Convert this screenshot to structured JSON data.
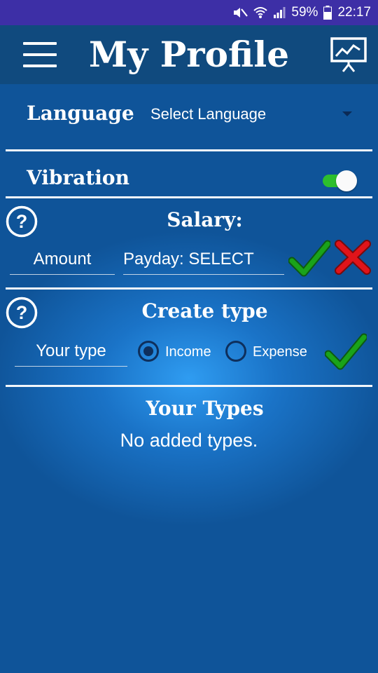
{
  "status_bar": {
    "battery": "59%",
    "time": "22:17",
    "icons": [
      "mute-icon",
      "wifi-icon",
      "signal-icon",
      "battery-icon"
    ]
  },
  "app_bar": {
    "title": "My Profile",
    "menu_icon": "hamburger-menu-icon",
    "chart_icon": "presentation-chart-icon"
  },
  "language": {
    "label": "Language",
    "selected": "Select Language"
  },
  "vibration": {
    "label": "Vibration",
    "enabled": true
  },
  "salary": {
    "title": "Salary:",
    "amount_placeholder": "Amount",
    "payday": "Payday: SELECT"
  },
  "create_type": {
    "title": "Create type",
    "type_placeholder": "Your type",
    "options": [
      {
        "label": "Income",
        "checked": true
      },
      {
        "label": "Expense",
        "checked": false
      }
    ]
  },
  "your_types": {
    "title": "Your Types",
    "empty_text": "No added types."
  },
  "colors": {
    "background": "#0f5499",
    "app_bar": "#104a7e",
    "status_bar": "#3d2fa6",
    "confirm": "#1aa31a",
    "cancel": "#e0141a",
    "toggle_track": "#2dbf2d"
  }
}
